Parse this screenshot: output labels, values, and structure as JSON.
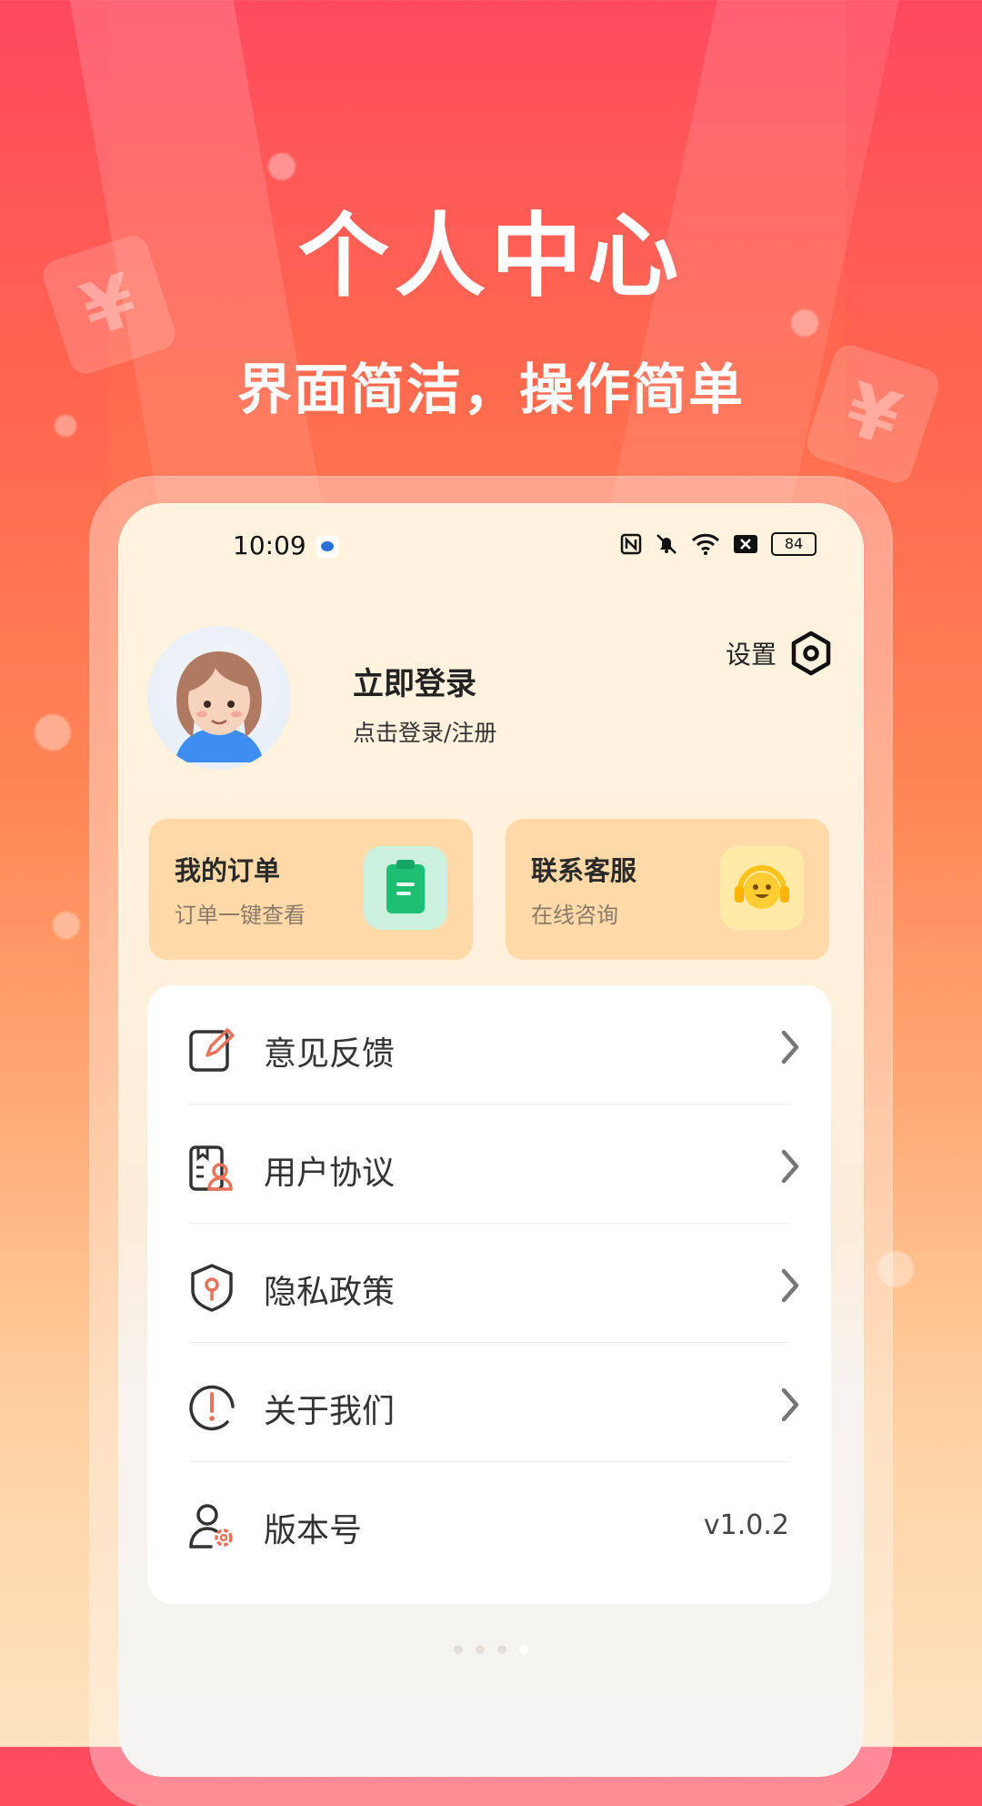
{
  "hero": {
    "title": "个人中心",
    "subtitle": "界面简洁，操作简单"
  },
  "statusbar": {
    "time": "10:09",
    "battery": "84",
    "icons": [
      "nfc-icon",
      "mute-bell-icon",
      "wifi-icon",
      "close-box-icon",
      "battery-icon"
    ]
  },
  "profile": {
    "title": "立即登录",
    "subtitle": "点击登录/注册",
    "settings_label": "设置"
  },
  "cards": [
    {
      "title": "我的订单",
      "subtitle": "订单一键查看",
      "icon": "clipboard-icon",
      "icon_color": "#1fbf73"
    },
    {
      "title": "联系客服",
      "subtitle": "在线咨询",
      "icon": "headset-smile-icon",
      "icon_color": "#ffcc33"
    }
  ],
  "menu": [
    {
      "label": "意见反馈",
      "icon": "edit-feedback-icon"
    },
    {
      "label": "用户协议",
      "icon": "user-agreement-icon"
    },
    {
      "label": "隐私政策",
      "icon": "privacy-shield-icon"
    },
    {
      "label": "关于我们",
      "icon": "info-circle-icon"
    },
    {
      "label": "版本号",
      "icon": "user-settings-icon",
      "value": "v1.0.2"
    }
  ],
  "colors": {
    "accent": "#e8735a",
    "card_bg": "#ffd9a8",
    "hero_top": "#ff4a5f"
  },
  "pager": {
    "count": 4,
    "active": 3
  }
}
